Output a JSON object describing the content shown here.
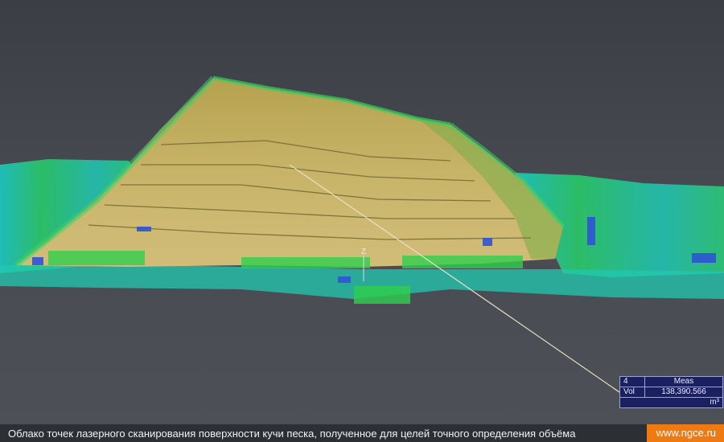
{
  "viewport": {
    "axis_label": "Z",
    "colors": {
      "background": "#44474d",
      "sand": "#c9b366",
      "sand_dark": "#9c8a44",
      "cloud_green": "#2ecf5a",
      "cloud_cyan": "#1ec8d8",
      "cloud_blue": "#2a4fd0",
      "measure_line": "#e8e2c4"
    }
  },
  "measurement": {
    "id": "4",
    "header": "Meas",
    "row_label": "Vol",
    "value": "138,390.566",
    "unit": "m³"
  },
  "caption": {
    "text": "Облако точек лазерного сканирования поверхности кучи песка, полученное для целей точного определения объёма",
    "site": "www.ngce.ru"
  }
}
